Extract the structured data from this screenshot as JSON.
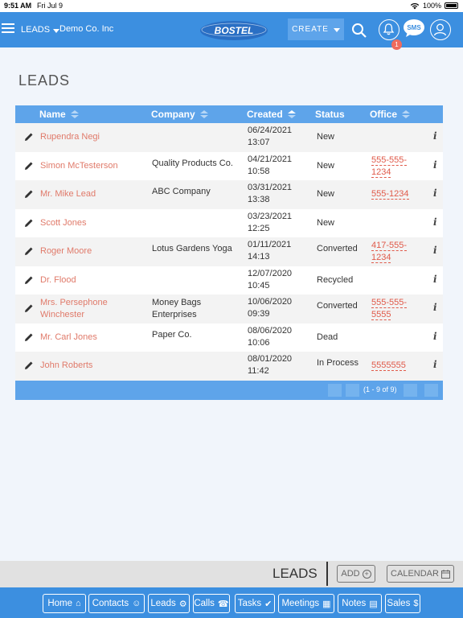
{
  "status_bar": {
    "time": "9:51 AM",
    "date": "Fri Jul 9",
    "battery": "100%"
  },
  "header": {
    "module": "LEADS",
    "company": "Demo Co. Inc",
    "logo": "BOSTEL",
    "create_label": "CREATE",
    "notification_count": "1",
    "sms_label": "SMS"
  },
  "page_title": "LEADS",
  "table": {
    "columns": {
      "name": "Name",
      "company": "Company",
      "created": "Created",
      "status": "Status",
      "office": "Office"
    },
    "rows": [
      {
        "name": "Rupendra Negi",
        "company": "",
        "created": "06/24/2021 13:07",
        "status": "New",
        "office": ""
      },
      {
        "name": "Simon McTesterson",
        "company": "Quality Products Co.",
        "created": "04/21/2021 10:58",
        "status": "New",
        "office": "555-555-1234"
      },
      {
        "name": "Mr. Mike Lead",
        "company": "ABC Company",
        "created": "03/31/2021 13:38",
        "status": "New",
        "office": "555-1234"
      },
      {
        "name": "Scott Jones",
        "company": "",
        "created": "03/23/2021 12:25",
        "status": "New",
        "office": ""
      },
      {
        "name": "Roger Moore",
        "company": "Lotus Gardens Yoga",
        "created": "01/11/2021 14:13",
        "status": "Converted",
        "office": "417-555-1234"
      },
      {
        "name": "Dr. Flood",
        "company": "",
        "created": "12/07/2020 10:45",
        "status": "Recycled",
        "office": ""
      },
      {
        "name": "Mrs. Persephone Winchester",
        "company": "Money Bags Enterprises",
        "created": "10/06/2020 09:39",
        "status": "Converted",
        "office": "555-555-5555"
      },
      {
        "name": "Mr. Carl Jones",
        "company": "Paper Co.",
        "created": "08/06/2020 10:06",
        "status": "Dead",
        "office": ""
      },
      {
        "name": "John Roberts",
        "company": "",
        "created": "08/01/2020 11:42",
        "status": "In Process",
        "office": "5555555"
      }
    ],
    "pagination": "(1 - 9 of 9)"
  },
  "subbar": {
    "title": "LEADS",
    "add_label": "ADD",
    "calendar_label": "CALENDAR"
  },
  "bottom_nav": [
    {
      "label": "Home",
      "icon": "home-icon"
    },
    {
      "label": "Contacts",
      "icon": "person-icon"
    },
    {
      "label": "Leads",
      "icon": "gear-icon"
    },
    {
      "label": "Calls",
      "icon": "phone-icon"
    },
    {
      "label": "Tasks",
      "icon": "check-icon"
    },
    {
      "label": "Meetings",
      "icon": "calendar-icon"
    },
    {
      "label": "Notes",
      "icon": "notes-icon"
    },
    {
      "label": "Sales",
      "icon": "dollar-icon"
    }
  ]
}
